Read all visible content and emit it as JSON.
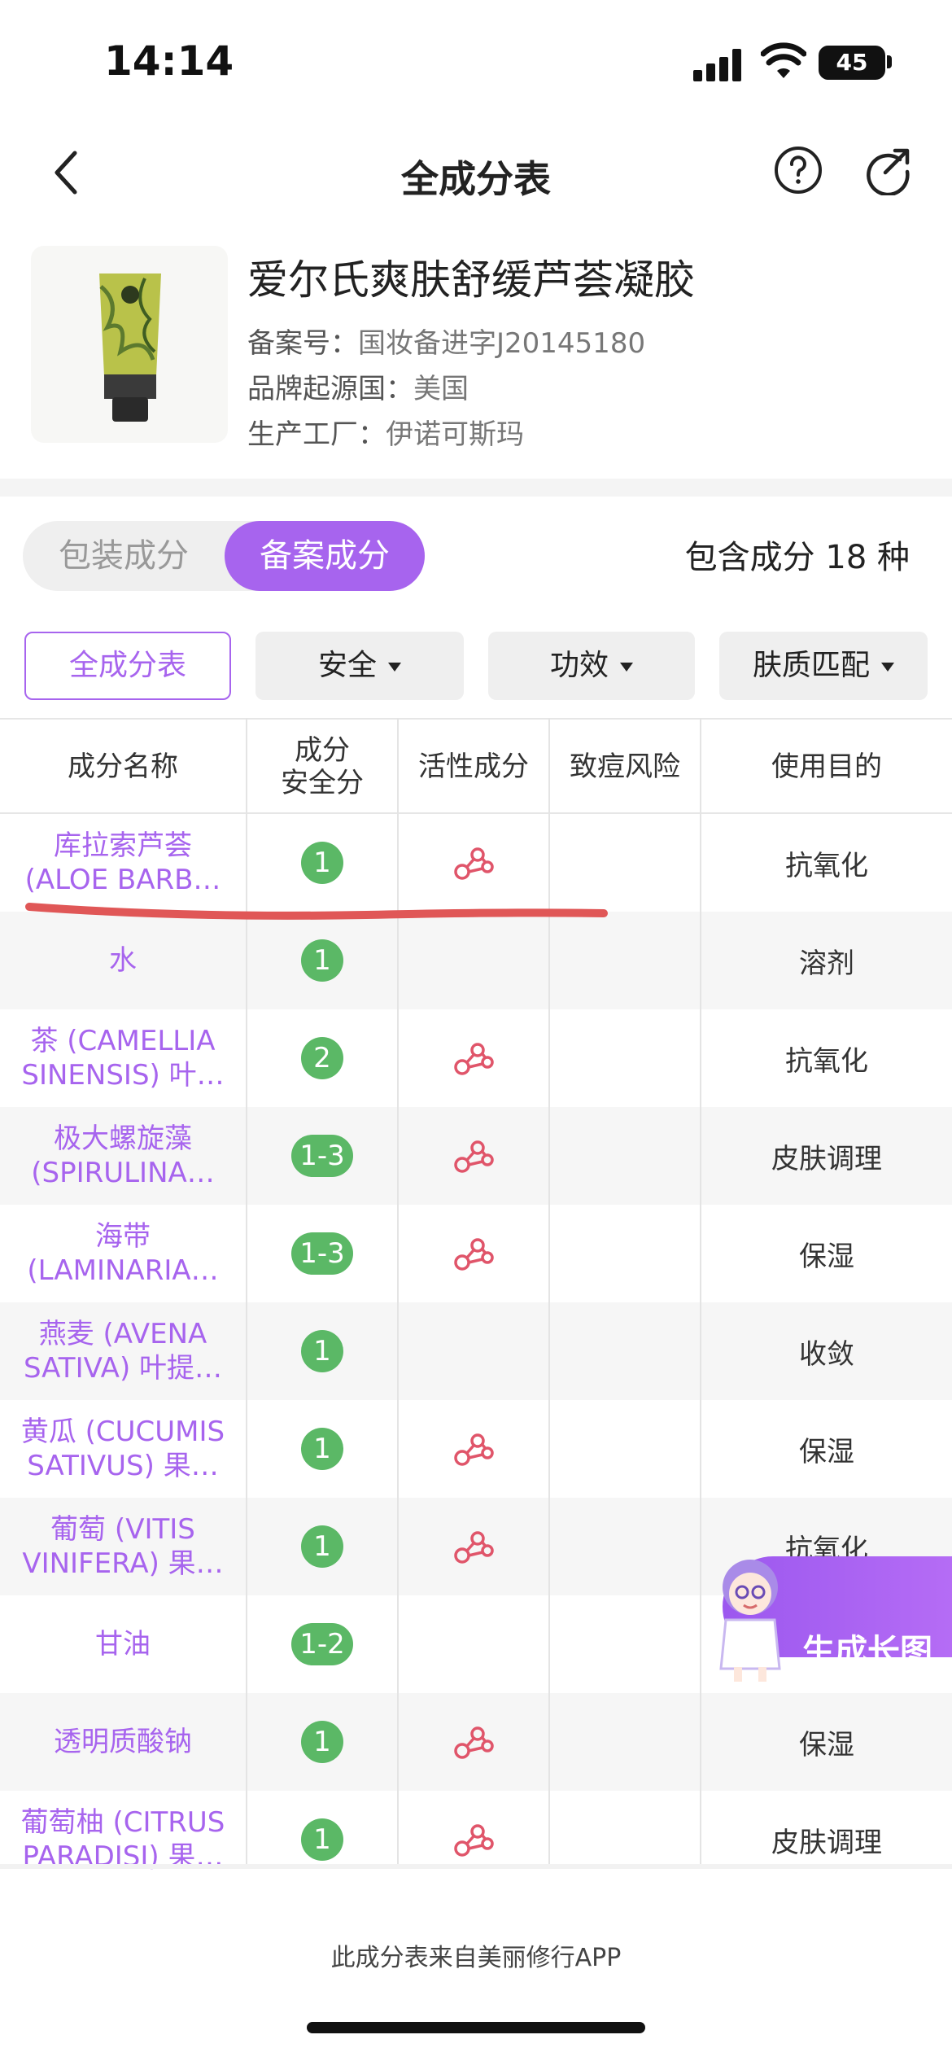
{
  "status": {
    "time": "14:14",
    "battery": "45"
  },
  "nav": {
    "title": "全成分表"
  },
  "product": {
    "name": "爱尔氏爽肤舒缓芦荟凝胶",
    "record_label": "备案号：",
    "record_value": "国妆备进字J20145180",
    "origin_label": "品牌起源国：",
    "origin_value": "美国",
    "factory_label": "生产工厂：",
    "factory_value": "伊诺可斯玛"
  },
  "tabs": {
    "packaging": "包装成分",
    "filed": "备案成分",
    "count_text": "包含成分 18 种"
  },
  "filters": {
    "all": "全成分表",
    "safety": "安全",
    "effect": "功效",
    "skin": "肤质匹配"
  },
  "table": {
    "headers": [
      "成分名称",
      "成分\n安全分",
      "活性成分",
      "致痘风险",
      "使用目的"
    ],
    "rows": [
      {
        "name": "库拉索芦荟\n(ALOE BARB…",
        "score": "1",
        "active": true,
        "use": "抗氧化"
      },
      {
        "name": "水",
        "score": "1",
        "active": false,
        "use": "溶剂"
      },
      {
        "name": "茶 (CAMELLIA\nSINENSIS) 叶…",
        "score": "2",
        "active": true,
        "use": "抗氧化"
      },
      {
        "name": "极大螺旋藻\n(SPIRULINA…",
        "score": "1-3",
        "active": true,
        "use": "皮肤调理"
      },
      {
        "name": "海带\n(LAMINARIA…",
        "score": "1-3",
        "active": true,
        "use": "保湿"
      },
      {
        "name": "燕麦 (AVENA\nSATIVA) 叶提…",
        "score": "1",
        "active": false,
        "use": "收敛"
      },
      {
        "name": "黄瓜 (CUCUMIS\nSATIVUS) 果…",
        "score": "1",
        "active": true,
        "use": "保湿"
      },
      {
        "name": "葡萄 (VITIS\nVINIFERA) 果…",
        "score": "1",
        "active": true,
        "use": "抗氧化"
      },
      {
        "name": "甘油",
        "score": "1-2",
        "active": false,
        "use": ""
      },
      {
        "name": "透明质酸钠",
        "score": "1",
        "active": true,
        "use": "保湿"
      },
      {
        "name": "葡萄柚 (CITRUS\nPARADISI) 果…",
        "score": "1",
        "active": true,
        "use": "皮肤调理"
      }
    ]
  },
  "float_button": {
    "label": "生成长图"
  },
  "footer": {
    "text": "此成分表来自美丽修行APP"
  },
  "colors": {
    "accent": "#a764ee",
    "badge": "#5bb866",
    "active_icon": "#e0556a",
    "annotation": "#e05757"
  }
}
